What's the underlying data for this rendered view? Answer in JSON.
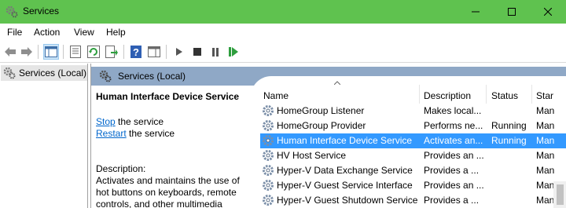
{
  "window": {
    "title": "Services"
  },
  "menu": {
    "file": "File",
    "action": "Action",
    "view": "View",
    "help": "Help"
  },
  "tree": {
    "root_label": "Services (Local)"
  },
  "pane": {
    "header": "Services (Local)"
  },
  "details": {
    "service_title": "Human Interface Device Service",
    "stop_link": "Stop",
    "stop_suffix": " the service",
    "restart_link": "Restart",
    "restart_suffix": " the service",
    "description_label": "Description:",
    "description_text": "Activates and maintains the use of hot buttons on keyboards, remote controls, and other multimedia"
  },
  "columns": {
    "name": "Name",
    "description": "Description",
    "status": "Status",
    "startup": "Star"
  },
  "rows": [
    {
      "name": "HomeGroup Listener",
      "description": "Makes local...",
      "status": "",
      "startup": "Man"
    },
    {
      "name": "HomeGroup Provider",
      "description": "Performs ne...",
      "status": "Running",
      "startup": "Man"
    },
    {
      "name": "Human Interface Device Service",
      "description": "Activates an...",
      "status": "Running",
      "startup": "Man"
    },
    {
      "name": "HV Host Service",
      "description": "Provides an ...",
      "status": "",
      "startup": "Man"
    },
    {
      "name": "Hyper-V Data Exchange Service",
      "description": "Provides a ...",
      "status": "",
      "startup": "Man"
    },
    {
      "name": "Hyper-V Guest Service Interface",
      "description": "Provides an ...",
      "status": "",
      "startup": "Man"
    },
    {
      "name": "Hyper-V Guest Shutdown Service",
      "description": "Provides a ...",
      "status": "",
      "startup": "Man"
    }
  ],
  "selected_row": "Human Interface Device Service",
  "colors": {
    "titlebar": "#5fc24f",
    "pane_header": "#8fa8c6",
    "selection": "#3399ff",
    "link": "#0066cc"
  },
  "icons": {
    "app": "gears-icon",
    "minimize": "minimize-icon",
    "maximize": "maximize-icon",
    "close": "close-icon",
    "toolbar": [
      "back-arrow-icon",
      "forward-arrow-icon",
      "console-tree-icon",
      "properties-icon",
      "refresh-icon",
      "export-list-icon",
      "help-icon",
      "show-hide-pane-icon",
      "start-service-icon",
      "stop-service-icon",
      "pause-service-icon",
      "restart-service-icon"
    ],
    "service_row": "gear-icon"
  }
}
